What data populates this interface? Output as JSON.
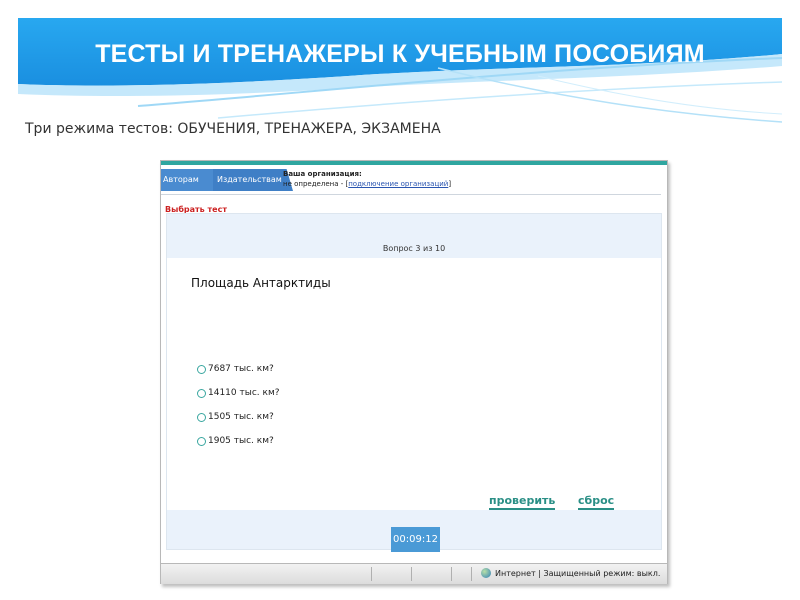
{
  "slide": {
    "title": "ТЕСТЫ И ТРЕНАЖЕРЫ К УЧЕБНЫМ ПОСОБИЯМ",
    "subtitle": "Три режима тестов: ОБУЧЕНИЯ, ТРЕНАЖЕРА, ЭКЗАМЕНА",
    "header_color": "#1e9be8"
  },
  "app": {
    "tabs": [
      {
        "label": "Авторам"
      },
      {
        "label": "Издательствам"
      }
    ],
    "org": {
      "title": "Ваша организация:",
      "status": "не определена - [",
      "link": "подключение организаций",
      "close": "]"
    },
    "choose_test": "Выбрать тест",
    "question_number": "Вопрос 3 из 10",
    "question": "Площадь Антарктиды",
    "answers": [
      {
        "label": "7687 тыс. км?"
      },
      {
        "label": "14110 тыс. км?"
      },
      {
        "label": "1505 тыс. км?"
      },
      {
        "label": "1905 тыс. км?"
      }
    ],
    "check_button": "проверить",
    "reset_button": "сброс",
    "timer": "00:09:12"
  },
  "statusbar": {
    "text": "Интернет | Защищенный режим: выкл."
  },
  "icons": {
    "radio": "radio-empty-icon",
    "globe": "globe-icon"
  }
}
